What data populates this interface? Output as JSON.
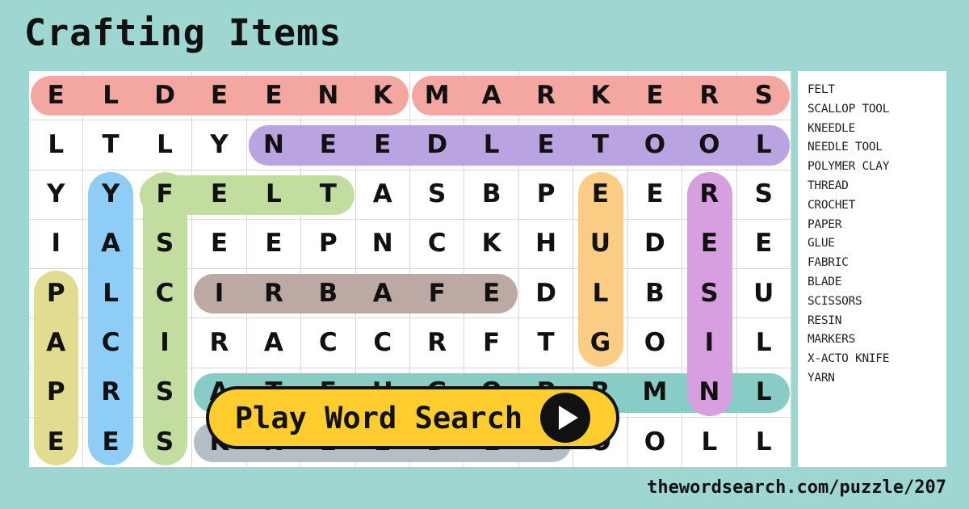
{
  "title": "Crafting Items",
  "footer": {
    "url": "thewordsearch.com/puzzle/207"
  },
  "play_button": {
    "label": "Play Word Search",
    "icon": "play-triangle-icon"
  },
  "colors": {
    "background": "#9ed6d2",
    "panel": "#ffffff",
    "grid_line": "#d8d8d8",
    "letter": "#111111",
    "button_fill": "#ffce2e",
    "button_border": "#111111",
    "highlight_salmon": "#f4a6a0",
    "highlight_purple": "#b9a3e0",
    "highlight_green": "#c3dda0",
    "highlight_blue": "#8ecdf5",
    "highlight_yellow": "#e2dc90",
    "highlight_orange": "#fbcd84",
    "highlight_violet": "#d79ee0",
    "highlight_brown": "#bda9a4",
    "highlight_teal": "#87cdc6",
    "highlight_gray": "#b3bfc4"
  },
  "grid": {
    "rows": 8,
    "cols": 14,
    "letters": [
      [
        "E",
        "L",
        "D",
        "E",
        "E",
        "N",
        "K",
        "M",
        "A",
        "R",
        "K",
        "E",
        "R",
        "S"
      ],
      [
        "L",
        "T",
        "L",
        "Y",
        "N",
        "E",
        "E",
        "D",
        "L",
        "E",
        "T",
        "O",
        "O",
        "L"
      ],
      [
        "Y",
        "Y",
        "F",
        "E",
        "L",
        "T",
        "A",
        "S",
        "B",
        "P",
        "E",
        "E",
        "R",
        "S"
      ],
      [
        "I",
        "A",
        "S",
        "E",
        "E",
        "P",
        "N",
        "C",
        "K",
        "H",
        "U",
        "D",
        "E",
        "E"
      ],
      [
        "P",
        "L",
        "C",
        "I",
        "R",
        "B",
        "A",
        "F",
        "E",
        "D",
        "L",
        "B",
        "S",
        "U"
      ],
      [
        "A",
        "C",
        "I",
        "R",
        "A",
        "C",
        "C",
        "R",
        "F",
        "T",
        "G",
        "O",
        "I",
        "L"
      ],
      [
        "P",
        "R",
        "S",
        "A",
        "T",
        "E",
        "H",
        "G",
        "O",
        "P",
        "R",
        "M",
        "N",
        "L"
      ],
      [
        "E",
        "E",
        "S",
        "K",
        "N",
        "E",
        "E",
        "D",
        "L",
        "E",
        "O",
        "O",
        "L",
        "L"
      ]
    ]
  },
  "highlights": [
    {
      "word": "ELDEENK",
      "color": "#f4a6a0",
      "row": 0,
      "col_start": 0,
      "col_end": 6,
      "orientation": "horizontal"
    },
    {
      "word": "MARKERS",
      "color": "#f4a6a0",
      "row": 0,
      "col_start": 7,
      "col_end": 13,
      "orientation": "horizontal"
    },
    {
      "word": "NEEDLE TOOL",
      "color": "#b9a3e0",
      "row": 1,
      "col_start": 4,
      "col_end": 13,
      "orientation": "horizontal"
    },
    {
      "word": "FELT",
      "color": "#c3dda0",
      "row": 2,
      "col_start": 2,
      "col_end": 5,
      "orientation": "horizontal"
    },
    {
      "word": "FABRIC",
      "color": "#bda9a4",
      "row": 4,
      "col_start": 3,
      "col_end": 8,
      "orientation": "horizontal"
    },
    {
      "word": "SCALLOP TOOL",
      "color": "#87cdc6",
      "row": 6,
      "col_start": 3,
      "col_end": 13,
      "orientation": "horizontal"
    },
    {
      "word": "KNEEDLE",
      "color": "#b3bfc4",
      "row": 7,
      "col_start": 3,
      "col_end": 9,
      "orientation": "horizontal"
    },
    {
      "word": "PAPER",
      "color": "#e2dc90",
      "col": 0,
      "row_start": 4,
      "row_end": 7,
      "orientation": "vertical"
    },
    {
      "word": "YARN",
      "color": "#8ecdf5",
      "col": 1,
      "row_start": 2,
      "row_end": 7,
      "orientation": "vertical"
    },
    {
      "word": "SCISSORS",
      "color": "#c3dda0",
      "col": 2,
      "row_start": 2,
      "row_end": 7,
      "orientation": "vertical"
    },
    {
      "word": "GLUE",
      "color": "#fbcd84",
      "col": 10,
      "row_start": 2,
      "row_end": 5,
      "orientation": "vertical"
    },
    {
      "word": "RESIN",
      "color": "#d79ee0",
      "col": 12,
      "row_start": 2,
      "row_end": 6,
      "orientation": "vertical"
    }
  ],
  "wordlist": [
    "FELT",
    "SCALLOP TOOL",
    "KNEEDLE",
    "NEEDLE TOOL",
    "POLYMER CLAY",
    "THREAD",
    "CROCHET",
    "PAPER",
    "GLUE",
    "FABRIC",
    "BLADE",
    "SCISSORS",
    "RESIN",
    "MARKERS",
    "X-ACTO KNIFE",
    "YARN"
  ]
}
